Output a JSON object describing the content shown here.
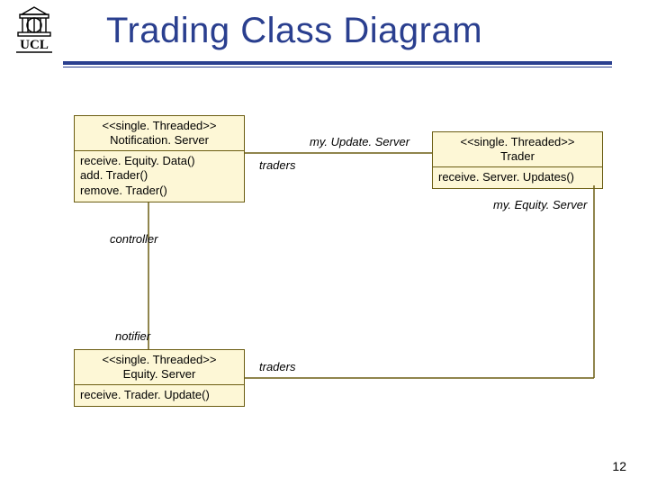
{
  "title": "Trading Class Diagram",
  "page_number": "12",
  "classes": {
    "notification_server": {
      "stereotype": "<<single. Threaded>>",
      "name": "Notification. Server",
      "ops": [
        "receive. Equity. Data()",
        "add. Trader()",
        "remove. Trader()"
      ]
    },
    "trader": {
      "stereotype": "<<single. Threaded>>",
      "name": "Trader",
      "ops": [
        "receive. Server. Updates()"
      ]
    },
    "equity_server": {
      "stereotype": "<<single. Threaded>>",
      "name": "Equity. Server",
      "ops": [
        "receive. Trader. Update()"
      ]
    }
  },
  "labels": {
    "myUpdateServer": "my. Update. Server",
    "traders_top": "traders",
    "myEquityServer": "my. Equity. Server",
    "controller": "controller",
    "notifier": "notifier",
    "traders_bottom": "traders"
  }
}
